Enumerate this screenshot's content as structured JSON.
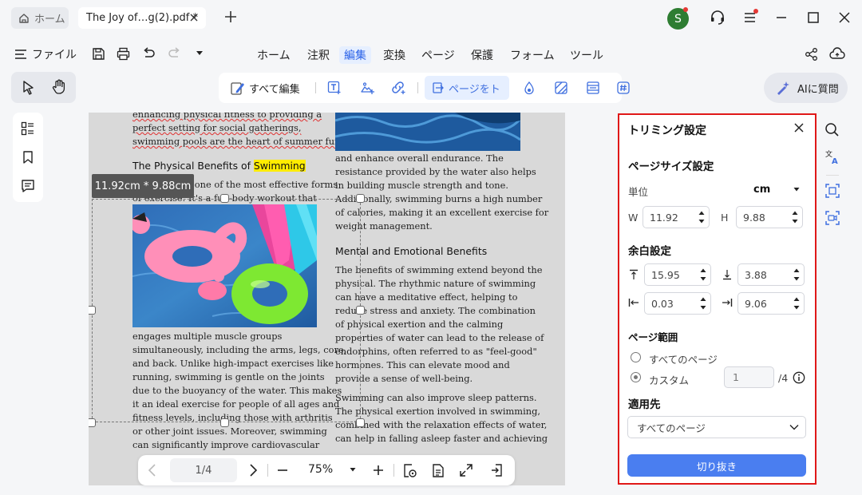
{
  "tabs": {
    "home_label": "ホーム",
    "doc_label": "The Joy of…g(2).pdf *"
  },
  "account": {
    "avatar_letter": "S"
  },
  "menu": {
    "file_label": "ファイル",
    "items": [
      "ホーム",
      "注釈",
      "編集",
      "変換",
      "ページ",
      "保護",
      "フォーム",
      "ツール"
    ],
    "active": "編集"
  },
  "tools": {
    "edit_all_label": "すべて編集",
    "page_label": "ページをト",
    "ai_label": "AIに質問"
  },
  "document": {
    "size_tip": "11.92cm * 9.88cm",
    "left_top_lines": [
      "enhancing physical fitness to providing a",
      "perfect setting for social gatherings,",
      "swimming pools are the heart of summer fun."
    ],
    "heading1_prefix": "The Physical Benefits of ",
    "heading1_highlight": "Swimming",
    "left_partial_lines": [
      "Swimming is one of the most effective forms",
      "of exercise. It's a full-body workout that"
    ],
    "left_body_lines": [
      "engages multiple muscle groups",
      "simultaneously, including the arms, legs, core,",
      "and back. Unlike high-impact exercises like",
      "running, swimming is gentle on the joints",
      "due to the buoyancy of the water. This makes",
      "it an ideal exercise for people of all ages and",
      "fitness levels, including those with arthritis",
      "or other joint issues. Moreover, swimming",
      "can significantly improve cardiovascular"
    ],
    "right_top_lines": [
      "and enhance overall endurance. The",
      "resistance provided by the water also helps",
      "in building muscle strength and tone.",
      "Additionally, swimming burns a high number",
      "of calories, making it an excellent exercise for",
      "weight management."
    ],
    "heading2": "Mental and Emotional Benefits",
    "right_mid_lines": [
      "The benefits of swimming extend beyond the",
      "physical. The rhythmic nature of swimming",
      "can have a meditative effect, helping to",
      "reduce stress and anxiety. The combination",
      "of physical exertion and the calming",
      "properties of water can lead to the release of",
      "endorphins, often referred to as \"feel-good\"",
      "hormones. This can elevate mood and",
      "provide a sense of well-being."
    ],
    "right_bottom_lines": [
      "Swimming can also improve sleep patterns.",
      "The physical exertion involved in swimming,",
      "combined with the relaxation effects of water,",
      "can help in falling asleep faster and achieving"
    ]
  },
  "nav": {
    "page_indicator": "1/4",
    "zoom": "75%"
  },
  "crop_panel": {
    "title": "トリミング設定",
    "page_size_title": "ページサイズ設定",
    "unit_label": "単位",
    "unit_value": "cm",
    "w_label": "W",
    "w_value": "11.92",
    "h_label": "H",
    "h_value": "9.88",
    "margin_title": "余白設定",
    "margin_top": "15.95",
    "margin_bottom": "3.88",
    "margin_left": "0.03",
    "margin_right": "9.06",
    "range_title": "ページ範囲",
    "range_all": "すべてのページ",
    "range_custom": "カスタム",
    "custom_page": "1",
    "custom_total": "/4",
    "apply_title": "適用先",
    "apply_value": "すべてのページ",
    "crop_button": "切り抜き"
  },
  "colors": {
    "accent": "#2a62e8",
    "panel_border": "#e01818",
    "crop_button": "#4a7ef0",
    "avatar": "#2e7d32",
    "highlight": "#ffec00"
  }
}
